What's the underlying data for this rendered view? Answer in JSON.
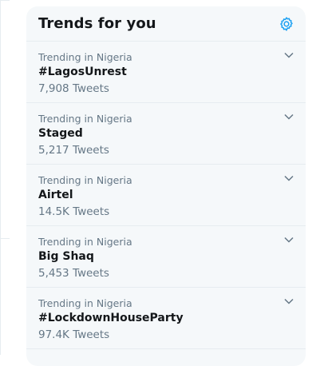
{
  "panel": {
    "title": "Trends for you",
    "settings_icon": "gear-icon",
    "accent_color": "#1da1f2"
  },
  "trends": [
    {
      "context": "Trending in Nigeria",
      "name": "#LagosUnrest",
      "count": "7,908 Tweets"
    },
    {
      "context": "Trending in Nigeria",
      "name": "Staged",
      "count": "5,217 Tweets"
    },
    {
      "context": "Trending in Nigeria",
      "name": "Airtel",
      "count": "14.5K Tweets"
    },
    {
      "context": "Trending in Nigeria",
      "name": "Big Shaq",
      "count": "5,453 Tweets"
    },
    {
      "context": "Trending in Nigeria",
      "name": "#LockdownHouseParty",
      "count": "97.4K Tweets"
    }
  ]
}
